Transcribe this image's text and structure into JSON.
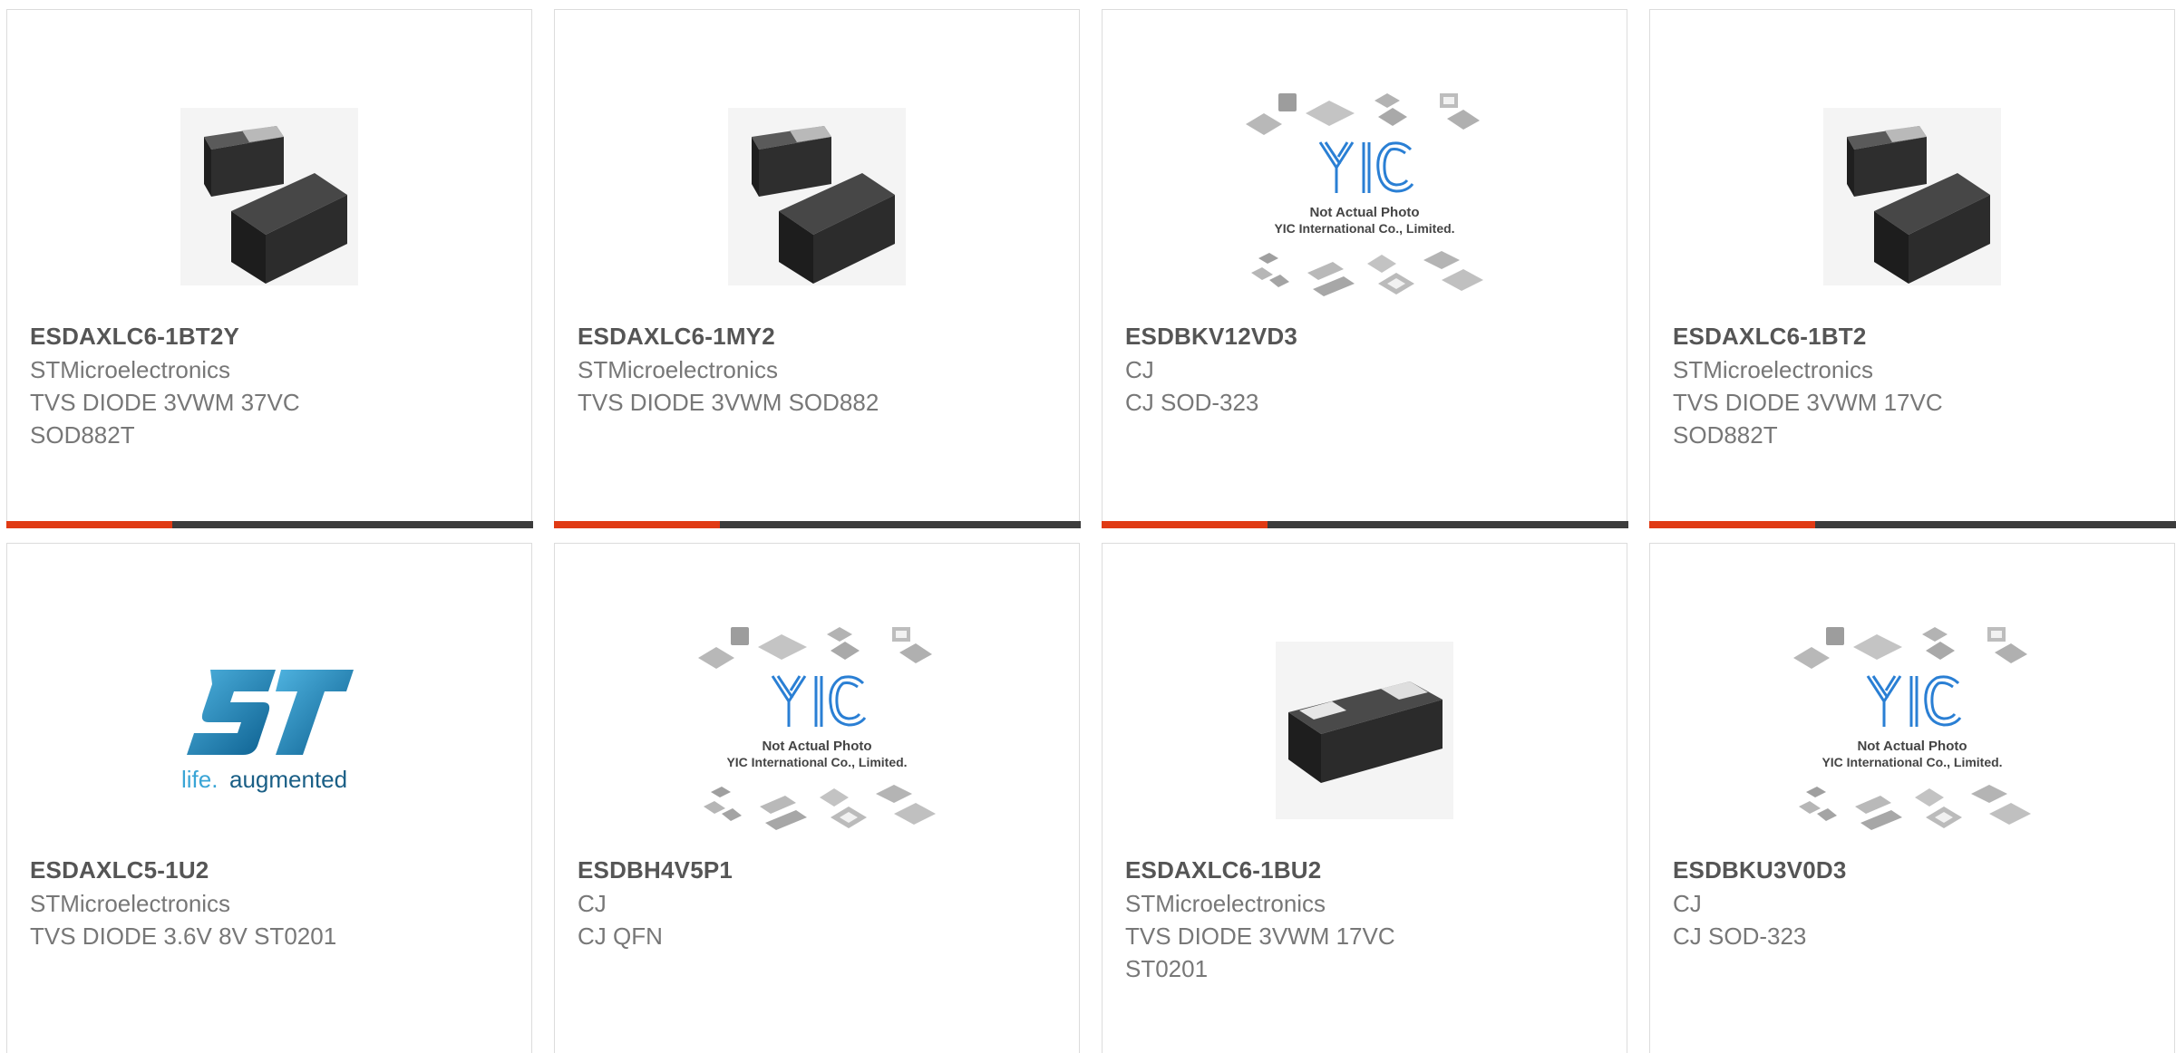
{
  "products": [
    {
      "part": "ESDAXLC6-1BT2Y",
      "manufacturer": "STMicroelectronics",
      "description": "TVS DIODE 3VWM 37VC\nSOD882T",
      "image": "sod882t-chip-pair"
    },
    {
      "part": "ESDAXLC6-1MY2",
      "manufacturer": "STMicroelectronics",
      "description": "TVS DIODE 3VWM SOD882",
      "image": "sod882t-chip-pair"
    },
    {
      "part": "ESDBKV12VD3",
      "manufacturer": "CJ",
      "description": "CJ SOD-323",
      "image": "yic-placeholder"
    },
    {
      "part": "ESDAXLC6-1BT2",
      "manufacturer": "STMicroelectronics",
      "description": "TVS DIODE 3VWM 17VC\nSOD882T",
      "image": "sod882t-chip-pair"
    },
    {
      "part": "ESDAXLC5-1U2",
      "manufacturer": "STMicroelectronics",
      "description": "TVS DIODE 3.6V 8V ST0201",
      "image": "st-logo"
    },
    {
      "part": "ESDBH4V5P1",
      "manufacturer": "CJ",
      "description": "CJ QFN",
      "image": "yic-placeholder"
    },
    {
      "part": "ESDAXLC6-1BU2",
      "manufacturer": "STMicroelectronics",
      "description": "TVS DIODE 3VWM 17VC\nST0201",
      "image": "st0201-chip"
    },
    {
      "part": "ESDBKU3V0D3",
      "manufacturer": "CJ",
      "description": "CJ SOD-323",
      "image": "yic-placeholder"
    }
  ],
  "placeholder": {
    "logo_text": "YIC",
    "line1": "Not Actual Photo",
    "line2": "YIC International Co., Limited."
  },
  "st_logo": {
    "tagline_a": "life.",
    "tagline_b": "augmented"
  },
  "colors": {
    "accent": "#e03a14",
    "bar_dark": "#3c3c3c",
    "part_text": "#555555",
    "meta_text": "#777777",
    "st_blue": "#1f8fbf",
    "yic_blue": "#2a7fd4"
  }
}
